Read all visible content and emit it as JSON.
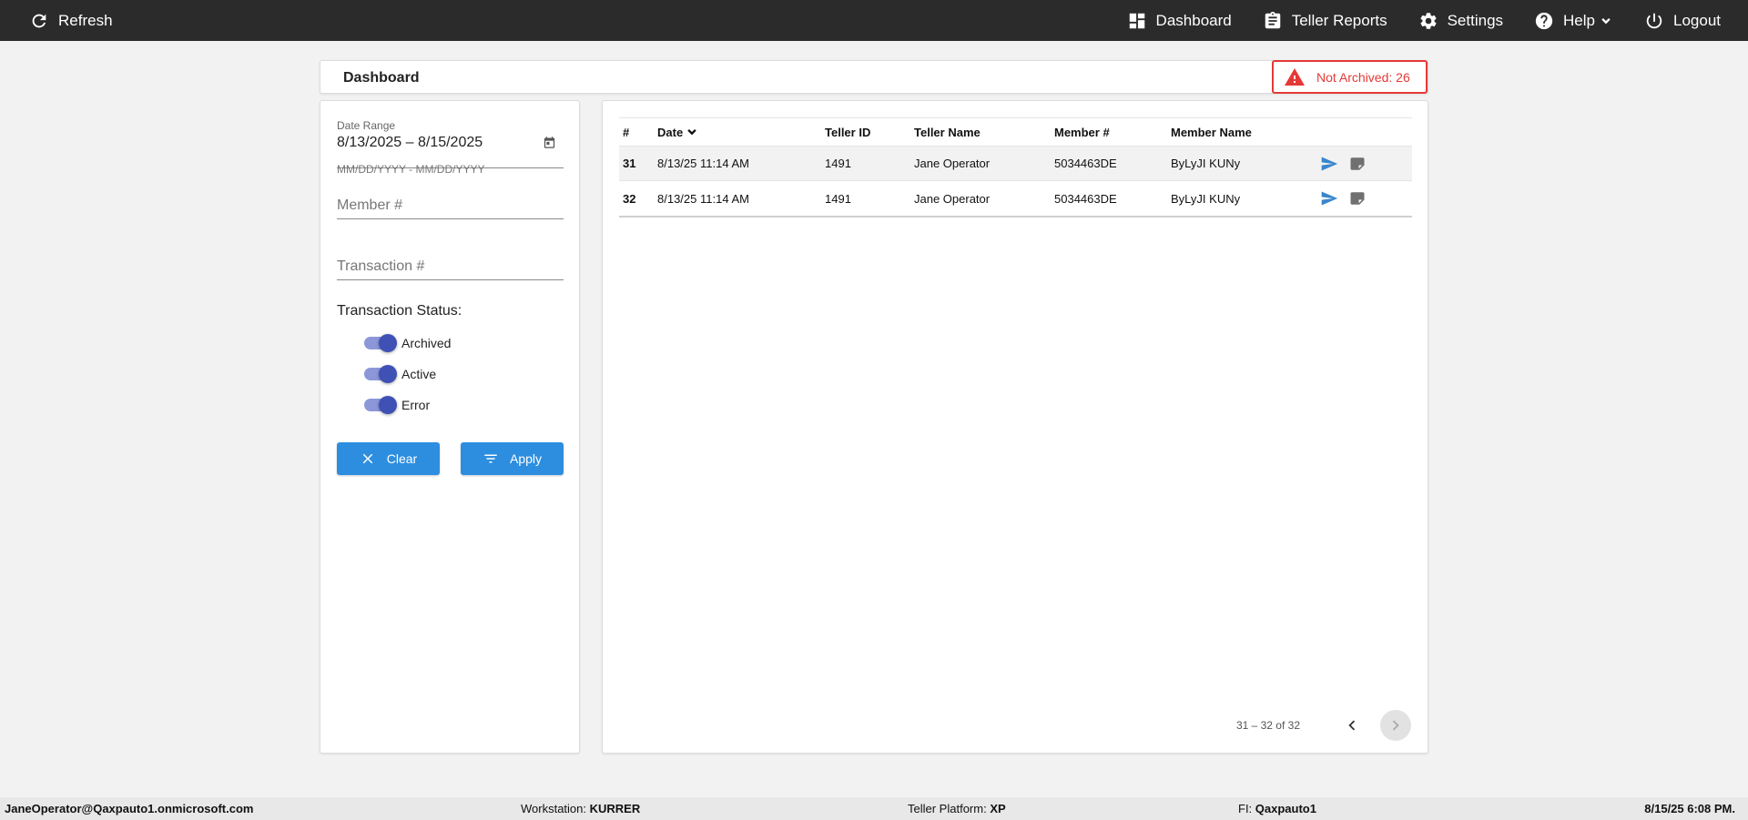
{
  "topbar": {
    "refresh_label": "Refresh",
    "nav": {
      "dashboard": "Dashboard",
      "teller_reports": "Teller Reports",
      "settings": "Settings",
      "help": "Help",
      "logout": "Logout"
    }
  },
  "header": {
    "title": "Dashboard",
    "alert": "Not Archived: 26"
  },
  "filters": {
    "date_range_label": "Date Range",
    "date_range_value": "8/13/2025 – 8/15/2025",
    "date_hint": "MM/DD/YYYY - MM/DD/YYYY",
    "member_placeholder": "Member #",
    "transaction_placeholder": "Transaction #",
    "status_label": "Transaction Status:",
    "toggles": [
      {
        "label": "Archived",
        "on": true
      },
      {
        "label": "Active",
        "on": true
      },
      {
        "label": "Error",
        "on": true
      }
    ],
    "clear_label": "Clear",
    "apply_label": "Apply"
  },
  "table": {
    "columns": [
      "#",
      "Date",
      "Teller ID",
      "Teller Name",
      "Member #",
      "Member Name"
    ],
    "rows": [
      {
        "num": "31",
        "date": "8/13/25 11:14 AM",
        "teller_id": "1491",
        "teller_name": "Jane Operator",
        "member_num": "5034463DE",
        "member_name": "ByLyJI KUNy"
      },
      {
        "num": "32",
        "date": "8/13/25 11:14 AM",
        "teller_id": "1491",
        "teller_name": "Jane Operator",
        "member_num": "5034463DE",
        "member_name": "ByLyJI KUNy"
      }
    ],
    "pager_text": "31 – 32 of 32"
  },
  "statusbar": {
    "user": "JaneOperator@Qaxpauto1.onmicrosoft.com",
    "workstation_label": "Workstation: ",
    "workstation_value": "KURRER",
    "platform_label": "Teller Platform: ",
    "platform_value": "XP",
    "fi_label": "FI: ",
    "fi_value": "Qaxpauto1",
    "datetime": "8/15/25 6:08 PM."
  },
  "colors": {
    "topbar": "#2b2b2b",
    "accent": "#2d8ee0",
    "toggle": "#3f51b5",
    "alert": "#e53935"
  }
}
